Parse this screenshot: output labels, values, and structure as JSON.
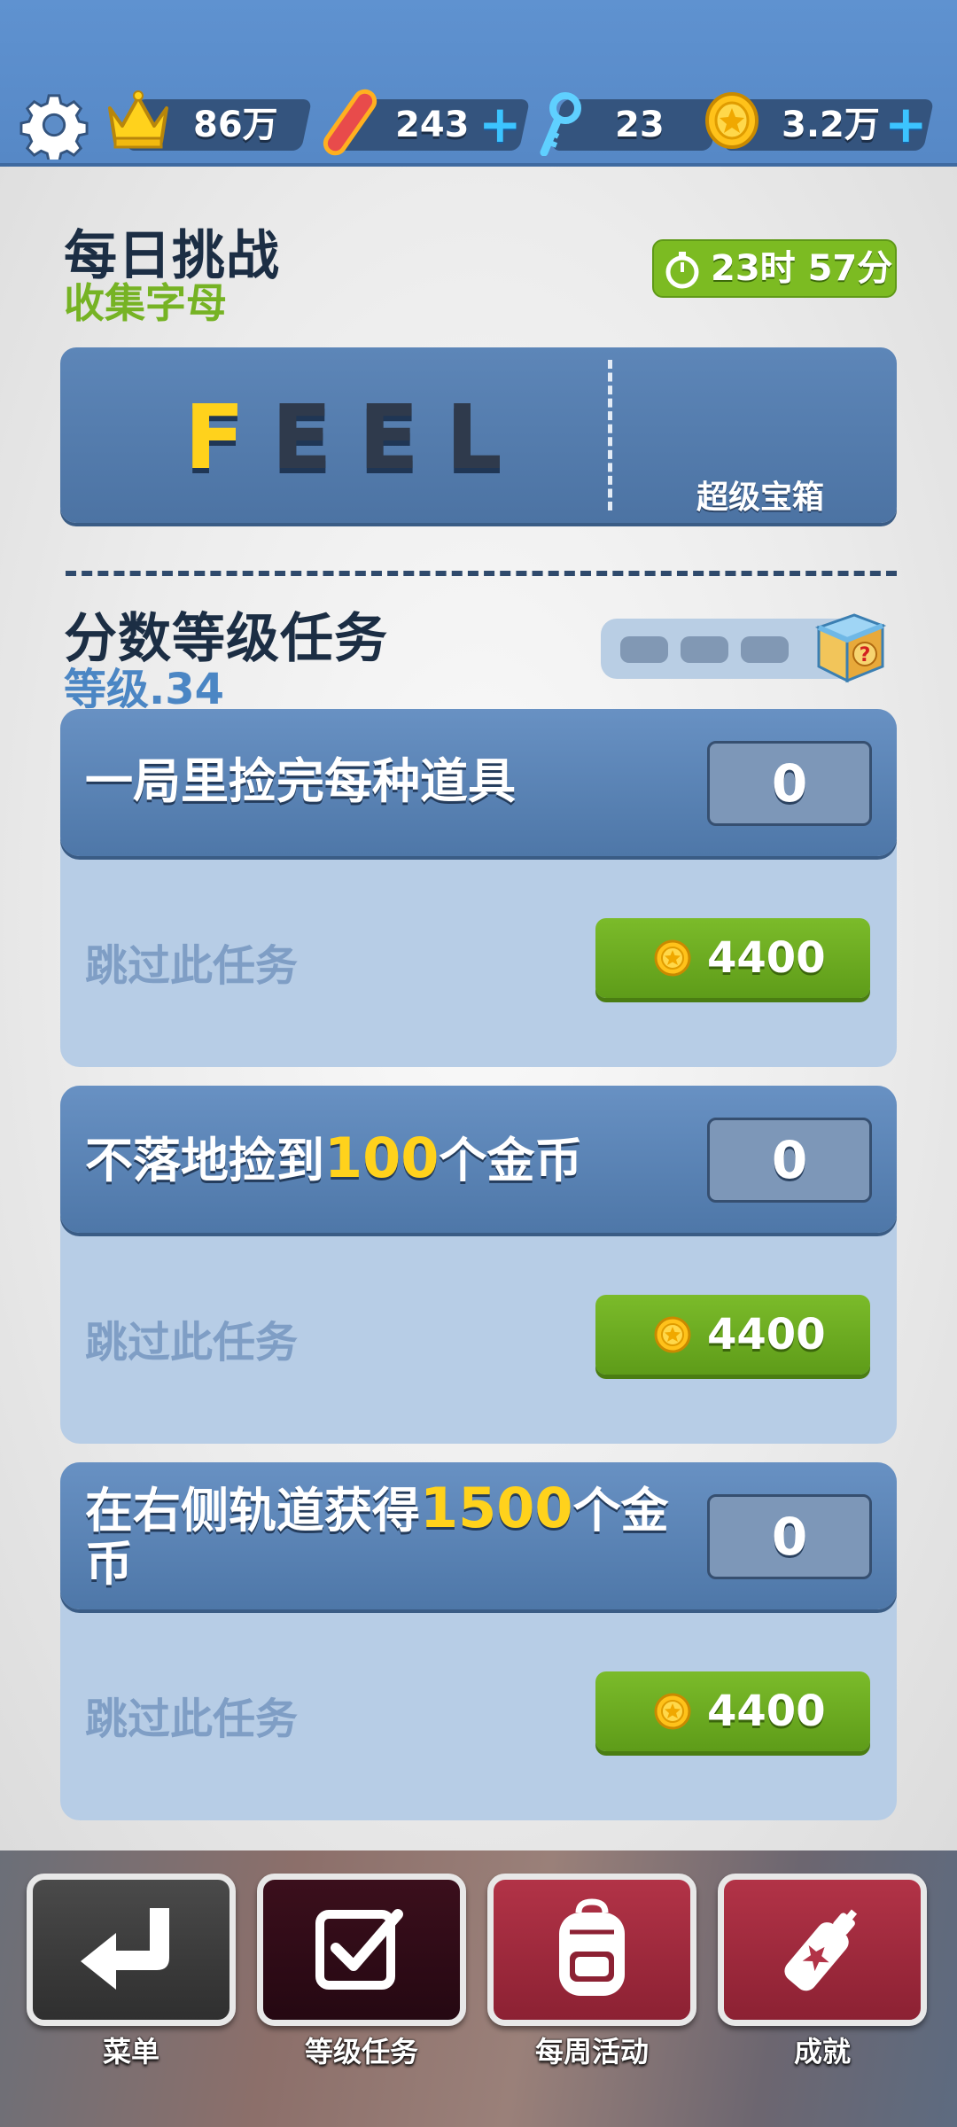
{
  "topbar": {
    "rank_value": "86万",
    "boards_value": "243",
    "keys_value": "23",
    "coins_value": "3.2万",
    "plus_symbol": "+"
  },
  "daily_challenge": {
    "title": "每日挑战",
    "subtitle": "收集字母",
    "timer": "23时 57分",
    "letters": [
      "F",
      "E",
      "E",
      "L"
    ],
    "collected_letters": 1,
    "chest_label": "超级宝箱"
  },
  "missions": {
    "title": "分数等级任务",
    "level_label": "等级.34",
    "progress_filled": 0,
    "progress_total": 3,
    "tasks": [
      {
        "title_parts": [
          "一局里捡完每种道具",
          "",
          ""
        ],
        "count": "0",
        "skip_label": "跳过此任务",
        "skip_price": "4400"
      },
      {
        "title_parts": [
          "不落地捡到",
          "100",
          "个金币"
        ],
        "count": "0",
        "skip_label": "跳过此任务",
        "skip_price": "4400"
      },
      {
        "title_parts": [
          "在右侧轨道获得",
          "1500",
          "个金币"
        ],
        "count": "0",
        "skip_label": "跳过此任务",
        "skip_price": "4400"
      }
    ]
  },
  "bottom_nav": [
    {
      "label": "菜单",
      "icon": "return-arrow-icon"
    },
    {
      "label": "等级任务",
      "icon": "checkbox-icon"
    },
    {
      "label": "每周活动",
      "icon": "backpack-icon"
    },
    {
      "label": "成就",
      "icon": "spray-can-icon"
    }
  ],
  "colors": {
    "accent_green": "#7cbb22",
    "highlight_yellow": "#ffd21c",
    "letter_collected": "#ffd21c",
    "letter_missing": "#2f3a4c"
  }
}
